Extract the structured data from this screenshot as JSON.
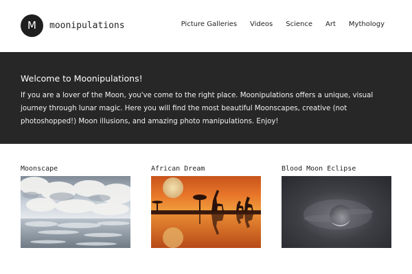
{
  "site": {
    "logo_letter": "M",
    "logo_text": "moonipulations"
  },
  "nav": {
    "items": [
      "Picture Galleries",
      "Videos",
      "Science",
      "Art",
      "Mythology"
    ]
  },
  "hero": {
    "title": "Welcome to Moonipulations!",
    "body": "If you are a lover of the Moon, you've come to the right place. Moonipulations offers a unique, visual journey through lunar magic. Here you will find the most beautiful Moonscapes, creative (not photoshopped!) Moon illusions, and amazing photo manipulations. Enjoy!"
  },
  "gallery": {
    "cards": [
      {
        "title": "Moonscape",
        "image": "clouds-over-water-image"
      },
      {
        "title": "African Dream",
        "image": "giraffes-at-sunset-image"
      },
      {
        "title": "Blood Moon Eclipse",
        "image": "eclipsed-moon-image"
      }
    ]
  },
  "colors": {
    "hero_background": "#272727",
    "logo_circle": "#1f1f1f",
    "text": "#222222"
  }
}
